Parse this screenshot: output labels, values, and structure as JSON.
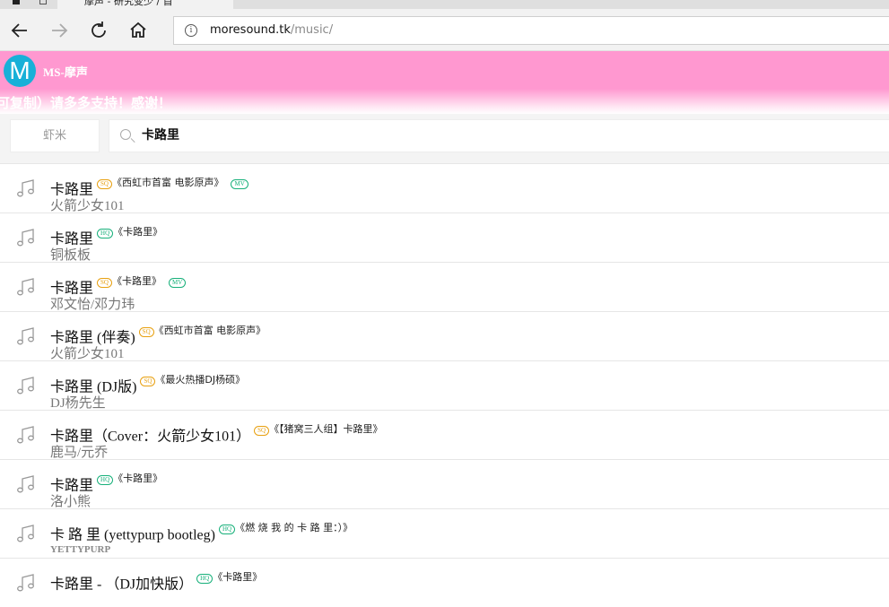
{
  "browser": {
    "tab_title": "摩声 - 研究变少 / 首",
    "address_host": "moresound.tk",
    "address_path": "/music/"
  },
  "header": {
    "logo_letter": "M",
    "brand": "MS-摩声",
    "marquee": "可复制）请多多支持！感谢！"
  },
  "search": {
    "source_label": "虾米",
    "query": "卡路里"
  },
  "songs": [
    {
      "title": "卡路里",
      "quality": "SQ",
      "album": "《西虹市首富 电影原声》",
      "mv": "MV",
      "artist": "火箭少女101"
    },
    {
      "title": "卡路里",
      "quality": "HQ",
      "album": "《卡路里》",
      "mv": "",
      "artist": "铜板板"
    },
    {
      "title": "卡路里",
      "quality": "SQ",
      "album": "《卡路里》",
      "mv": "MV",
      "artist": "邓文怡/邓力玮"
    },
    {
      "title": "卡路里 (伴奏)",
      "quality": "SQ",
      "album": "《西虹市首富 电影原声》",
      "mv": "",
      "artist": "火箭少女101"
    },
    {
      "title": "卡路里 (DJ版)",
      "quality": "SQ",
      "album": "《最火热播DJ杨硕》",
      "mv": "",
      "artist": "DJ杨先生"
    },
    {
      "title": "卡路里（Cover：火箭少女101）",
      "quality": "SQ",
      "album": "《【猪窝三人组】卡路里》",
      "mv": "",
      "artist": "鹿马/元乔"
    },
    {
      "title": "卡路里",
      "quality": "HQ",
      "album": "《卡路里》",
      "mv": "",
      "artist": "洛小熊"
    },
    {
      "title": "卡 路 里 (yettypurp bootleg)",
      "quality": "HQ",
      "album": "《燃 烧 我 的 卡 路 里：）》",
      "mv": "",
      "artist": "YETTYPURP"
    },
    {
      "title": "卡路里 - （DJ加快版）",
      "quality": "HQ",
      "album": "《卡路里》",
      "mv": "",
      "artist": ""
    }
  ]
}
